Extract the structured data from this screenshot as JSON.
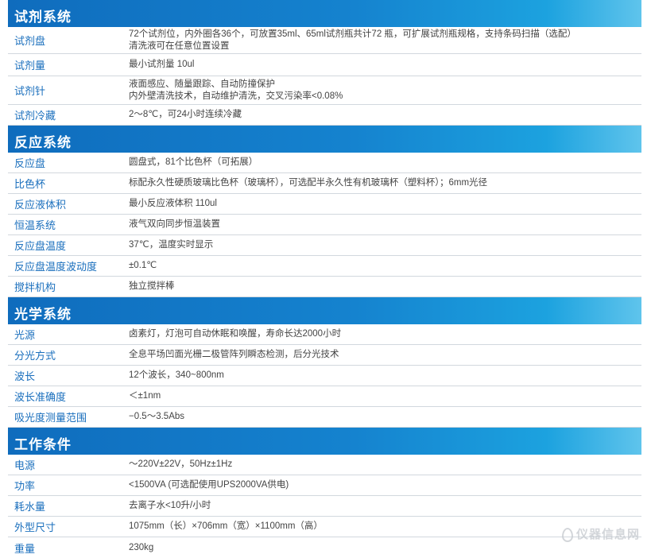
{
  "sections": [
    {
      "title": "试剂系统",
      "rows": [
        {
          "label": "试剂盘",
          "lines": [
            "72个试剂位，内外圈各36个，可放置35ml、65ml试剂瓶共计72 瓶，可扩展试剂瓶规格，支持条码扫描（选配）",
            "清洗液可在任意位置设置"
          ]
        },
        {
          "label": "试剂量",
          "lines": [
            "最小试剂量   10ul"
          ]
        },
        {
          "label": "试剂针",
          "lines": [
            "液面感应、随量跟踪、自动防撞保护",
            "内外壁清洗技术，自动维护清洗，交叉污染率<0.08%"
          ]
        },
        {
          "label": "试剂冷藏",
          "lines": [
            "2～8℃，可24小时连续冷藏"
          ]
        }
      ]
    },
    {
      "title": "反应系统",
      "rows": [
        {
          "label": "反应盘",
          "lines": [
            "圆盘式，81个比色杯（可拓展）"
          ]
        },
        {
          "label": "比色杯",
          "lines": [
            "标配永久性硬质玻璃比色杯（玻璃杯），可选配半永久性有机玻璃杯（塑料杯）；6mm光径"
          ]
        },
        {
          "label": "反应液体积",
          "lines": [
            "最小反应液体积  110ul"
          ]
        },
        {
          "label": "恒温系统",
          "lines": [
            "液气双向同步恒温装置"
          ]
        },
        {
          "label": "反应盘温度",
          "lines": [
            "37℃，温度实时显示"
          ]
        },
        {
          "label": "反应盘温度波动度",
          "lines": [
            "±0.1℃"
          ]
        },
        {
          "label": "搅拌机构",
          "lines": [
            "独立搅拌棒"
          ]
        }
      ]
    },
    {
      "title": "光学系统",
      "rows": [
        {
          "label": "光源",
          "lines": [
            "卤素灯，灯泡可自动休眠和唤醒，寿命长达2000小时"
          ]
        },
        {
          "label": "分光方式",
          "lines": [
            "全息平场凹面光栅二极管阵列瞬态检测，后分光技术"
          ]
        },
        {
          "label": "波长",
          "lines": [
            "12个波长，340~800nm"
          ]
        },
        {
          "label": "波长准确度",
          "lines": [
            "＜±1nm"
          ]
        },
        {
          "label": "吸光度测量范围",
          "lines": [
            "−0.5～3.5Abs"
          ]
        }
      ]
    },
    {
      "title": "工作条件",
      "rows": [
        {
          "label": "电源",
          "lines": [
            "～220V±22V，50Hz±1Hz"
          ]
        },
        {
          "label": "功率",
          "lines": [
            "<1500VA (可选配使用UPS2000VA供电)"
          ]
        },
        {
          "label": "耗水量",
          "lines": [
            "去离子水<10升/小时"
          ]
        },
        {
          "label": "外型尺寸",
          "lines": [
            "1075mm（长）×706mm（宽）×1100mm（高）"
          ]
        },
        {
          "label": "重量",
          "lines": [
            "230kg"
          ]
        }
      ]
    }
  ],
  "watermark": "仪器信息网"
}
